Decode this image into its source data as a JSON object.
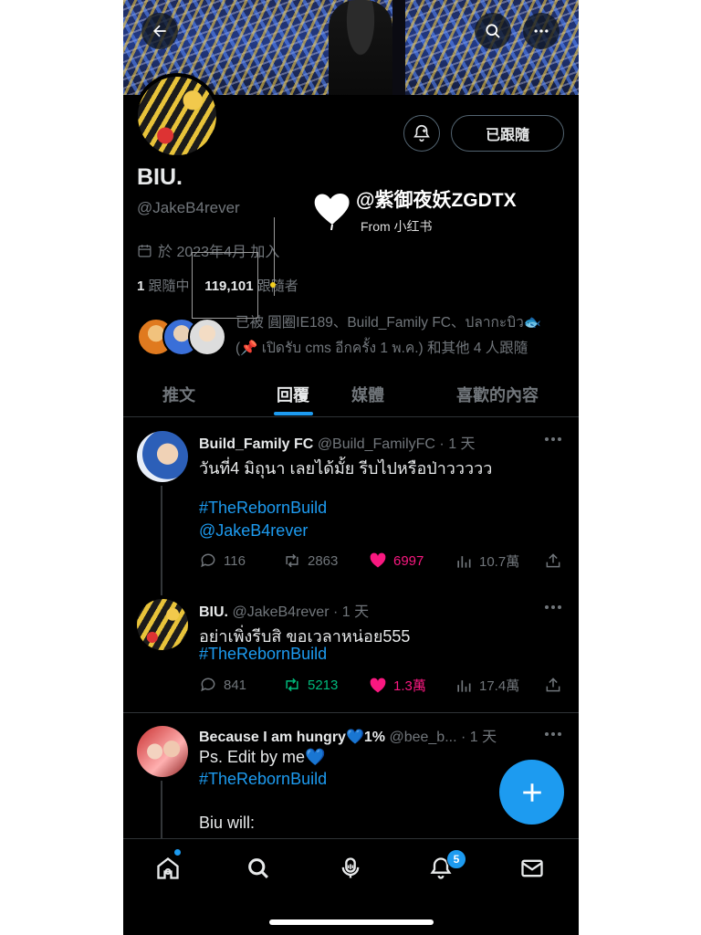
{
  "profile": {
    "follow_label": "已跟隨",
    "name": "BIU.",
    "handle": "@JakeB4rever",
    "joined": "於 2023年4月 加入",
    "following_count": "1",
    "following_label": "跟隨中",
    "followers_count": "119,101",
    "followers_label": "跟隨者",
    "followed_by_line1": "已被 圓圈IE189、Build_Family FC、ปลากะบิว🐟",
    "followed_by_line2": "(📌 เปิดรับ cms อีกครั้ง 1 พ.ค.) 和其他 4 人跟隨"
  },
  "watermark": {
    "title": "@紫御夜妖ZGDTX",
    "sub": "From 小红书"
  },
  "tabs": [
    {
      "label": "推文"
    },
    {
      "label": "回覆"
    },
    {
      "label": "媒體"
    },
    {
      "label": "喜歡的內容"
    }
  ],
  "tweets": [
    {
      "name": "Build_Family FC",
      "meta": "@Build_FamilyFC · 1 天",
      "lines": [
        "วันที่4 มิถุนา เลยได้มั้ย รีบไปหรือป่าววววว",
        "",
        "#TheRebornBuild",
        "@JakeB4rever"
      ],
      "reply": "116",
      "retweet": "2863",
      "like": "6997",
      "views": "10.7萬"
    },
    {
      "name": "BIU.",
      "meta": "@JakeB4rever · 1 天",
      "lines": [
        "อย่าเพิ่งรีบสิ ขอเวลาหน่อย555",
        "#TheRebornBuild"
      ],
      "reply": "841",
      "retweet": "5213",
      "like": "1.3萬",
      "views": "17.4萬"
    },
    {
      "name": "Because I am hungry💙1%",
      "meta": "@bee_b... · 1 天",
      "lines": [
        "Ps. Edit by me💙",
        "#TheRebornBuild",
        "",
        "Biu will:"
      ]
    }
  ],
  "nav": {
    "notification_badge": "5"
  },
  "colors": {
    "accent": "#1d9bf0",
    "like": "#f91880",
    "retweet": "#00ba7c",
    "muted": "#71767b"
  }
}
